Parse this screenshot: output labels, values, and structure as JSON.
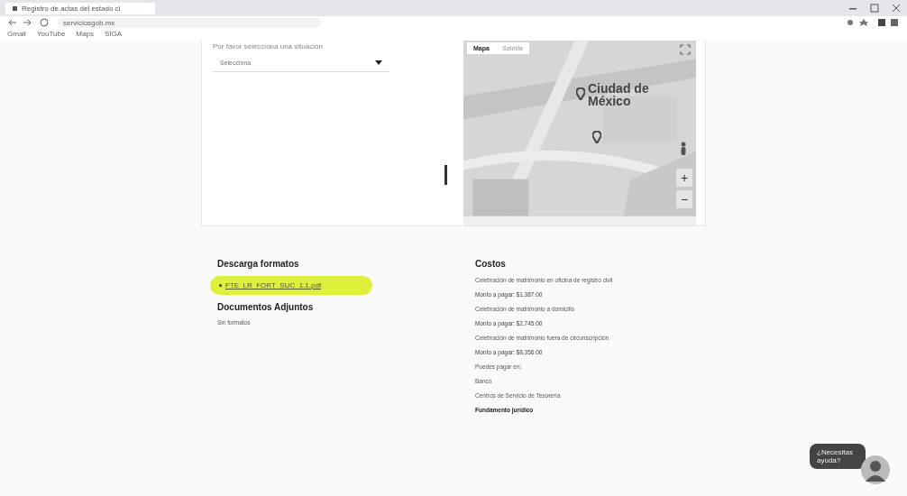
{
  "browser": {
    "tab_title": "Registro de actas del estado ci",
    "url": "serviciosgob.mx",
    "bookmarks": [
      "Gmail",
      "YouTube",
      "Maps",
      "SIGA"
    ]
  },
  "form": {
    "label": "Por favor selecciona una situación",
    "select": {
      "value": "Selecciona"
    }
  },
  "map": {
    "map_types": [
      {
        "label": "Mapa",
        "selected": true
      },
      {
        "label": "Satélite",
        "selected": false
      }
    ],
    "city_label": "Ciudad de México",
    "zoom_in": "+",
    "zoom_out": "−"
  },
  "downloads": {
    "title": "Descarga formatos",
    "links": [
      "FTE_LR_FORT_SUC_1.1.pdf"
    ]
  },
  "attachments": {
    "title": "Documentos Adjuntos",
    "empty": "Sin formatos"
  },
  "costs": {
    "title": "Costos",
    "lines": [
      {
        "text": "Celebración de matrimonio en oficina de registro civil",
        "kind": "item"
      },
      {
        "text": "Monto a pagar: $1,387.00",
        "kind": "amount"
      },
      {
        "text": "Celebración de matrimonio a domicilio",
        "kind": "item"
      },
      {
        "text": "Monto a pagar: $2,745.00",
        "kind": "amount"
      },
      {
        "text": "Celebración de matrimonio fuera de circunscripción",
        "kind": "item"
      },
      {
        "text": "Monto a pagar: $8,356.00",
        "kind": "amount"
      },
      {
        "text": "Puedes pagar en:",
        "kind": "item"
      },
      {
        "text": "Banco",
        "kind": "item"
      },
      {
        "text": "Centros de Servicio de Tesorería",
        "kind": "item"
      },
      {
        "text": "Fundamento jurídico",
        "kind": "heading"
      }
    ]
  },
  "chat": {
    "bubble": "¿Necesitas ayuda?"
  }
}
